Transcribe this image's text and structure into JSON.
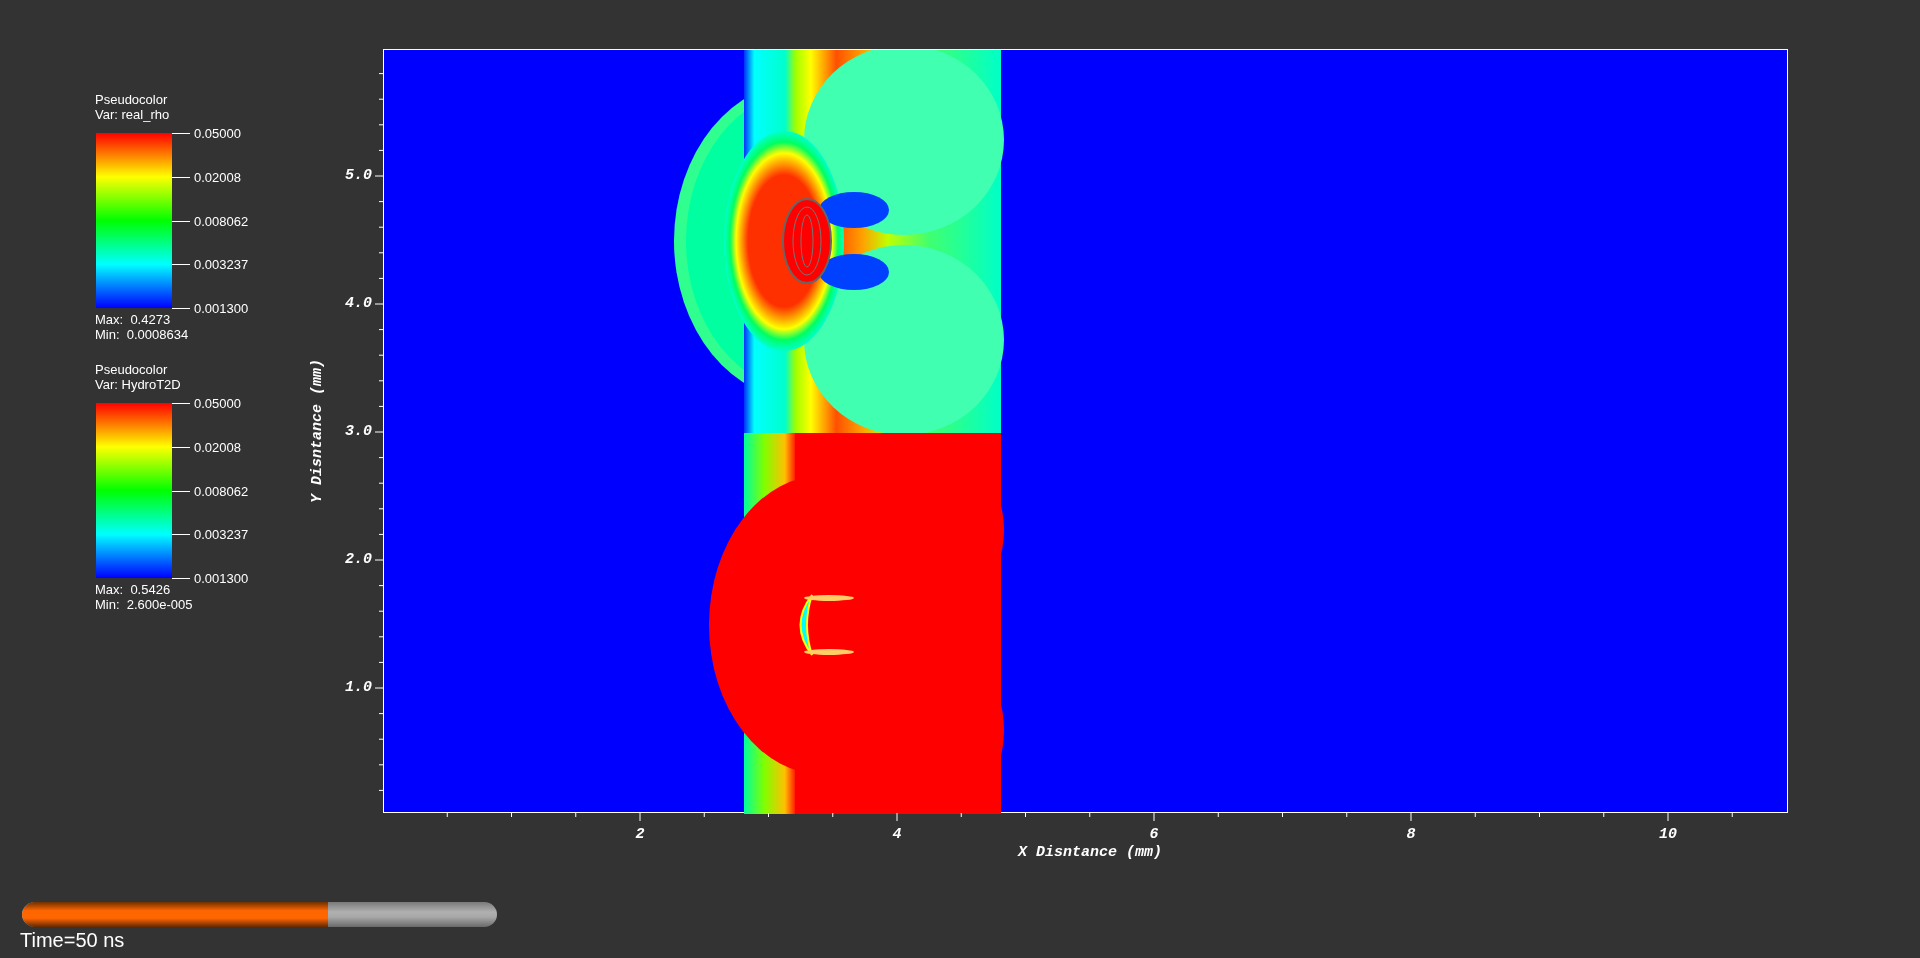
{
  "legends": [
    {
      "title": "Pseudocolor",
      "variable": "Var: real_rho",
      "ticks": [
        "0.05000",
        "0.02008",
        "0.008062",
        "0.003237",
        "0.001300"
      ],
      "max": "Max:  0.4273",
      "min": "Min:  0.0008634"
    },
    {
      "title": "Pseudocolor",
      "variable": "Var: HydroT2D",
      "ticks": [
        "0.05000",
        "0.02008",
        "0.008062",
        "0.003237",
        "0.001300"
      ],
      "max": "Max:  0.5426",
      "min": "Min:  2.600e-005"
    }
  ],
  "plot": {
    "x_axis": {
      "title": "X Disntance (mm)",
      "ticks": [
        "2",
        "4",
        "6",
        "8",
        "10"
      ]
    },
    "y_axis": {
      "title": "Y Disntance (mm)",
      "ticks": [
        "5.0",
        "4.0",
        "3.0",
        "2.0",
        "1.0"
      ]
    }
  },
  "time_slider": {
    "level": 0.644,
    "label": "Time=50 ns"
  }
}
